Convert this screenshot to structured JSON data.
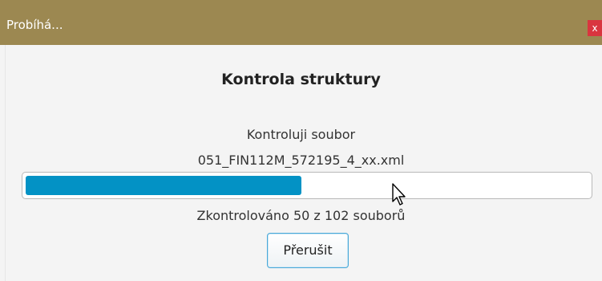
{
  "window": {
    "title": "Probíhá...",
    "close_label": "x"
  },
  "dialog": {
    "heading": "Kontrola struktury",
    "status_label": "Kontroluji soubor",
    "current_file": "051_FIN112M_572195_4_xx.xml",
    "progress": {
      "checked": 50,
      "total": 102,
      "fraction": 0.49
    },
    "counter_text": "Zkontrolováno 50 z 102 souborů",
    "abort_label": "Přerušit"
  },
  "colors": {
    "titlebar": "#9c8851",
    "close_button": "#d9353f",
    "progress_fill": "#0392c5",
    "button_focus_border": "#4aa8d8"
  },
  "icons": {
    "cursor": "mouse-pointer-icon"
  }
}
